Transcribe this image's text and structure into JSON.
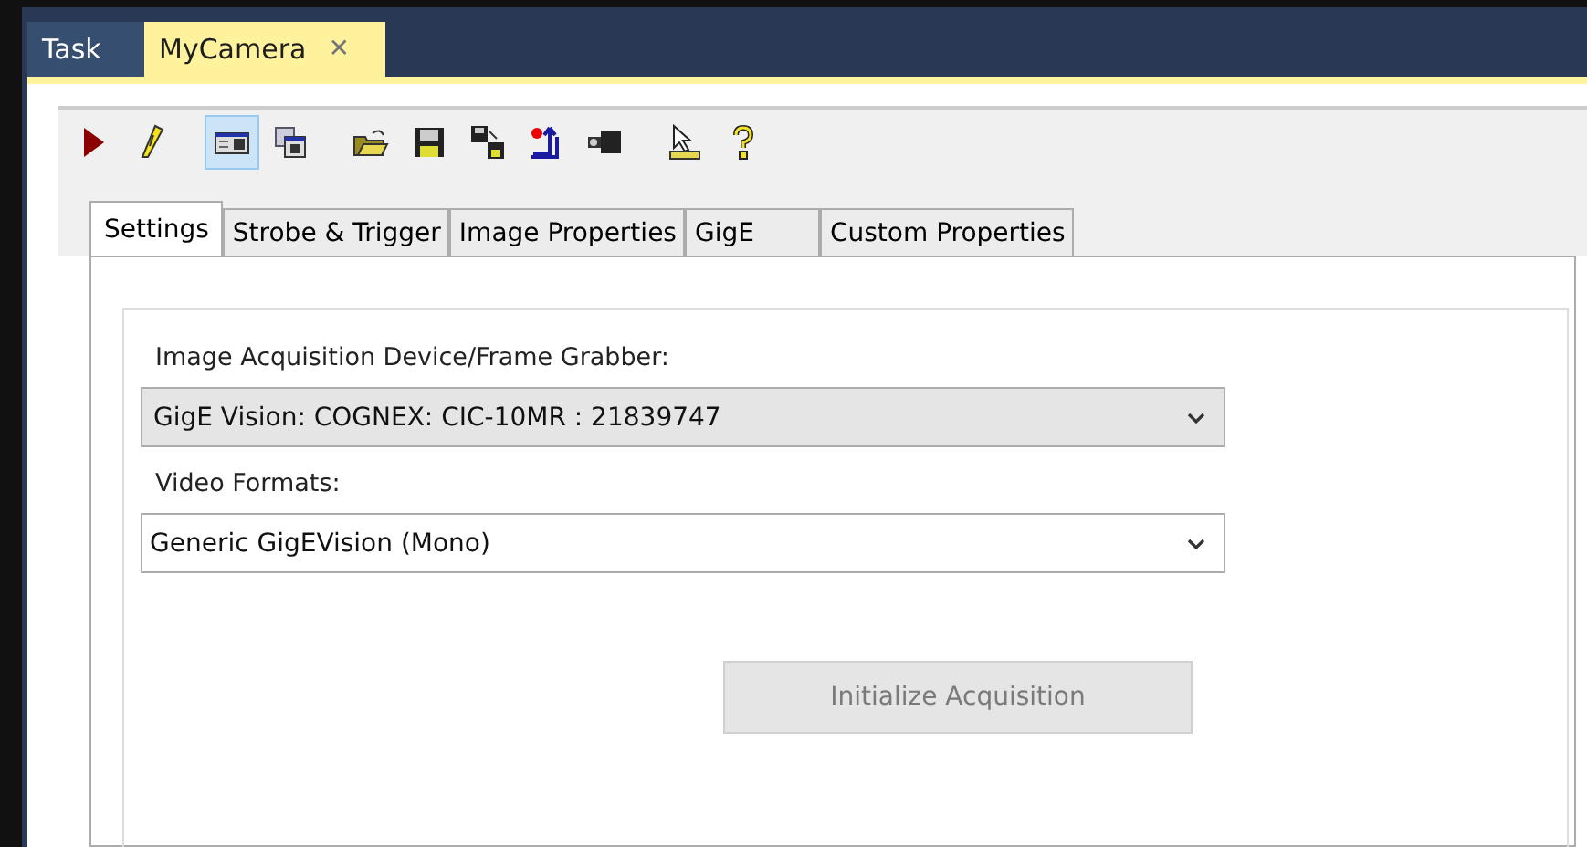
{
  "document_tabs": [
    {
      "label": "Task",
      "selected": false
    },
    {
      "label": "MyCamera",
      "selected": true,
      "close_glyph": "✕"
    }
  ],
  "toolbar": [
    {
      "selected": false
    },
    {
      "selected": false
    },
    {
      "selected": true
    },
    {
      "selected": false
    },
    {
      "selected": false
    },
    {
      "selected": false
    },
    {
      "selected": false
    },
    {
      "selected": false
    },
    {
      "selected": false
    },
    {
      "selected": false
    },
    {
      "selected": false
    }
  ],
  "tabs": [
    {
      "label": "Settings",
      "selected": true
    },
    {
      "label": "Strobe & Trigger",
      "selected": false
    },
    {
      "label": "Image Properties",
      "selected": false
    },
    {
      "label": "GigE",
      "selected": false
    },
    {
      "label": "Custom Properties",
      "selected": false
    }
  ],
  "fields": [
    {
      "label": "Image Acquisition Device/Frame Grabber:",
      "value": "GigE Vision: COGNEX: CIC-10MR : 21839747",
      "editable": false
    },
    {
      "label": "Video Formats:",
      "value": "Generic GigEVision (Mono)",
      "editable": true
    }
  ],
  "button": {
    "label": "Initialize Acquisition",
    "disabled": true
  }
}
